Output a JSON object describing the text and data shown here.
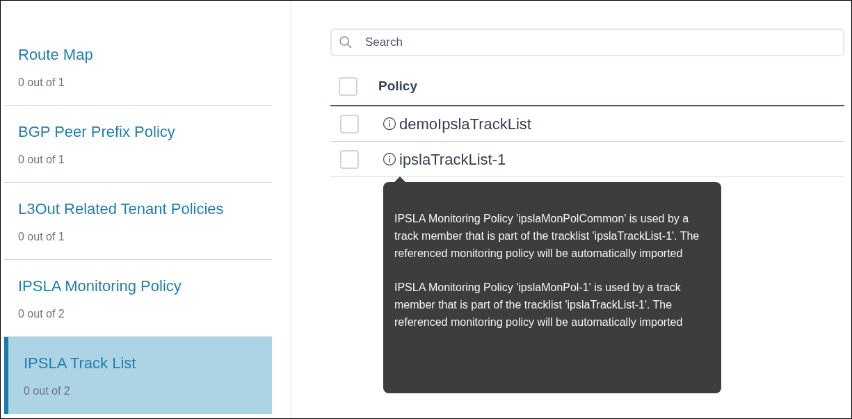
{
  "sidebar": {
    "items": [
      {
        "title": "Route Map",
        "count": "0 out of 1",
        "selected": false
      },
      {
        "title": "BGP Peer Prefix Policy",
        "count": "0 out of 1",
        "selected": false
      },
      {
        "title": "L3Out Related Tenant Policies",
        "count": "0 out of 1",
        "selected": false
      },
      {
        "title": "IPSLA Monitoring Policy",
        "count": "0 out of 2",
        "selected": false
      },
      {
        "title": "IPSLA Track List",
        "count": "0 out of 2",
        "selected": true
      }
    ]
  },
  "search": {
    "placeholder": "Search"
  },
  "table": {
    "columns": [
      {
        "label": "Policy",
        "checked": false
      }
    ],
    "rows": [
      {
        "name": "demoIpslaTrackList",
        "checked": false
      },
      {
        "name": "ipslaTrackList-1",
        "checked": false,
        "tooltip": [
          "IPSLA Monitoring Policy 'ipslaMonPolCommon' is used by a track member that is part of the tracklist 'ipslaTrackList-1'. The referenced monitoring policy will be automatically imported",
          "IPSLA Monitoring Policy 'ipslaMonPol-1' is used by a track member that is part of the tracklist 'ipslaTrackList-1'. The referenced monitoring policy will be automatically imported"
        ]
      }
    ]
  }
}
